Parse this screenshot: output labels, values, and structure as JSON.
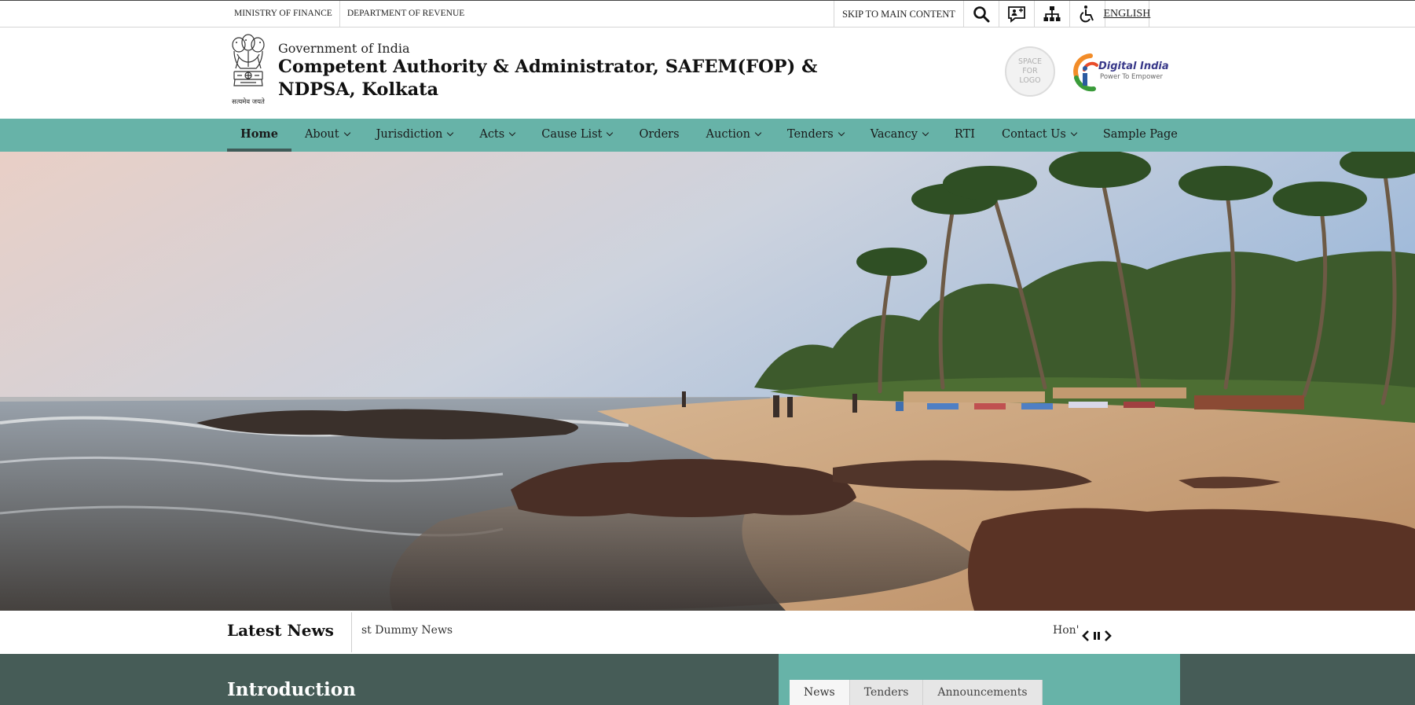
{
  "topbar": {
    "ministry": "MINISTRY OF FINANCE",
    "department": "DEPARTMENT OF REVENUE",
    "skip": "SKIP TO MAIN CONTENT",
    "language": "ENGLISH",
    "icons": [
      "search-icon",
      "screen-reader-icon",
      "sitemap-icon",
      "accessibility-icon"
    ]
  },
  "header": {
    "emblem_motto": "सत्यमेव जयते",
    "government": "Government of India",
    "title": "Competent Authority & Administrator, SAFEM(FOP) & NDPSA, Kolkata",
    "logo_placeholder": "SPACE FOR LOGO",
    "digital_india": "Digital India",
    "digital_india_tagline": "Power To Empower"
  },
  "nav": {
    "items": [
      {
        "label": "Home",
        "active": true,
        "dropdown": false
      },
      {
        "label": "About",
        "active": false,
        "dropdown": true
      },
      {
        "label": "Jurisdiction",
        "active": false,
        "dropdown": true
      },
      {
        "label": "Acts",
        "active": false,
        "dropdown": true
      },
      {
        "label": "Cause List",
        "active": false,
        "dropdown": true
      },
      {
        "label": "Orders",
        "active": false,
        "dropdown": false
      },
      {
        "label": "Auction",
        "active": false,
        "dropdown": true
      },
      {
        "label": "Tenders",
        "active": false,
        "dropdown": true
      },
      {
        "label": "Vacancy",
        "active": false,
        "dropdown": true
      },
      {
        "label": "RTI",
        "active": false,
        "dropdown": false
      },
      {
        "label": "Contact Us",
        "active": false,
        "dropdown": true
      },
      {
        "label": "Sample Page",
        "active": false,
        "dropdown": false
      }
    ]
  },
  "news": {
    "title": "Latest News",
    "ticker_left": "st Dummy News",
    "ticker_right": "Hon'",
    "controls": [
      "chevron-left-icon",
      "pause-icon",
      "chevron-right-icon"
    ]
  },
  "lower": {
    "intro_title": "Introduction",
    "tabs": [
      "News",
      "Tenders",
      "Announcements"
    ],
    "active_tab": "News"
  },
  "colors": {
    "nav_bg": "#67b3a8",
    "active_underline": "#3f5b58",
    "lower_bg": "#465c57",
    "tab_panel_bg": "#67b3a8"
  }
}
